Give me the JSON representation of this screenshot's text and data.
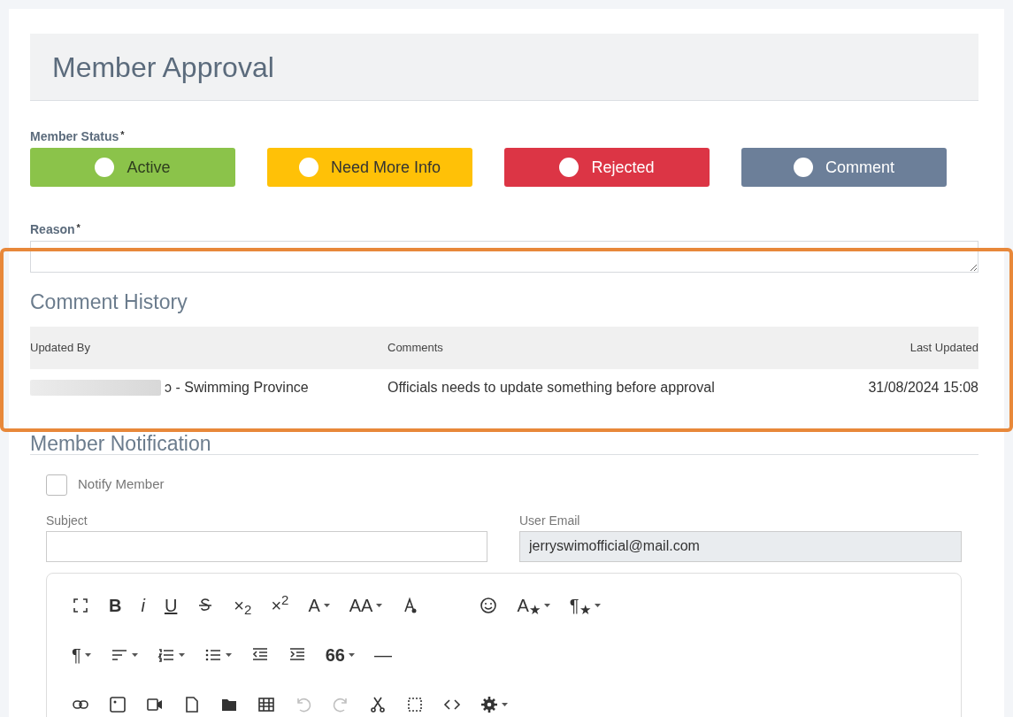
{
  "title": "Member Approval",
  "member_status": {
    "label": "Member Status",
    "required_mark": "*",
    "options": [
      {
        "label": "Active",
        "color": "#8bc34a",
        "selected": false
      },
      {
        "label": "Need More Info",
        "color": "#ffc107",
        "selected": false
      },
      {
        "label": "Rejected",
        "color": "#dc3545",
        "selected": false
      },
      {
        "label": "Comment",
        "color": "#6c7f99",
        "selected": false
      }
    ]
  },
  "reason": {
    "label": "Reason",
    "required_mark": "*"
  },
  "comment_history": {
    "title": "Comment History",
    "columns": [
      "Updated By",
      "Comments",
      "Last Updated"
    ],
    "rows": [
      {
        "updated_by": "ɔ - Swimming Province",
        "comment": "Officials needs to update something before approval",
        "last_updated": "31/08/2024 15:08"
      }
    ]
  },
  "member_notification": {
    "title": "Member Notification",
    "notify": {
      "label": "Notify Member",
      "checked": false
    },
    "subject": {
      "label": "Subject"
    },
    "user_email": {
      "label": "User Email",
      "value": "jerryswimofficial@mail.com"
    }
  },
  "toolbar_rows": [
    [
      {
        "kind": "fullscreen"
      },
      {
        "kind": "bold",
        "label": "B"
      },
      {
        "kind": "italic",
        "label": "i"
      },
      {
        "kind": "underline",
        "label": "U"
      },
      {
        "kind": "strike"
      },
      {
        "kind": "text",
        "label": "×$_{2}$"
      },
      {
        "kind": "text",
        "label": "×$^{2}$"
      },
      {
        "kind": "text",
        "label": "A",
        "dropdown": true
      },
      {
        "kind": "text",
        "label": "AA",
        "dropdown": true
      },
      {
        "kind": "clear-format"
      },
      {
        "kind": "spacer"
      },
      {
        "kind": "emoji"
      },
      {
        "kind": "text",
        "label": "A$_{★}$",
        "dropdown": true
      },
      {
        "kind": "text",
        "label": "¶$_{★}$",
        "dropdown": true
      }
    ],
    [
      {
        "kind": "text",
        "label": "¶",
        "dropdown": true
      },
      {
        "kind": "align",
        "dropdown": true
      },
      {
        "kind": "ordered-list",
        "dropdown": true
      },
      {
        "kind": "bullet-list",
        "dropdown": true
      },
      {
        "kind": "outdent"
      },
      {
        "kind": "indent"
      },
      {
        "kind": "bold",
        "label": "66",
        "dropdown": true
      },
      {
        "kind": "text",
        "label": "—"
      }
    ],
    [
      {
        "kind": "link"
      },
      {
        "kind": "image"
      },
      {
        "kind": "video"
      },
      {
        "kind": "file"
      },
      {
        "kind": "folder"
      },
      {
        "kind": "table"
      },
      {
        "kind": "undo",
        "disabled": true
      },
      {
        "kind": "redo",
        "disabled": true
      },
      {
        "kind": "cut"
      },
      {
        "kind": "select-all"
      },
      {
        "kind": "code"
      },
      {
        "kind": "gear",
        "dropdown": true
      }
    ]
  ]
}
